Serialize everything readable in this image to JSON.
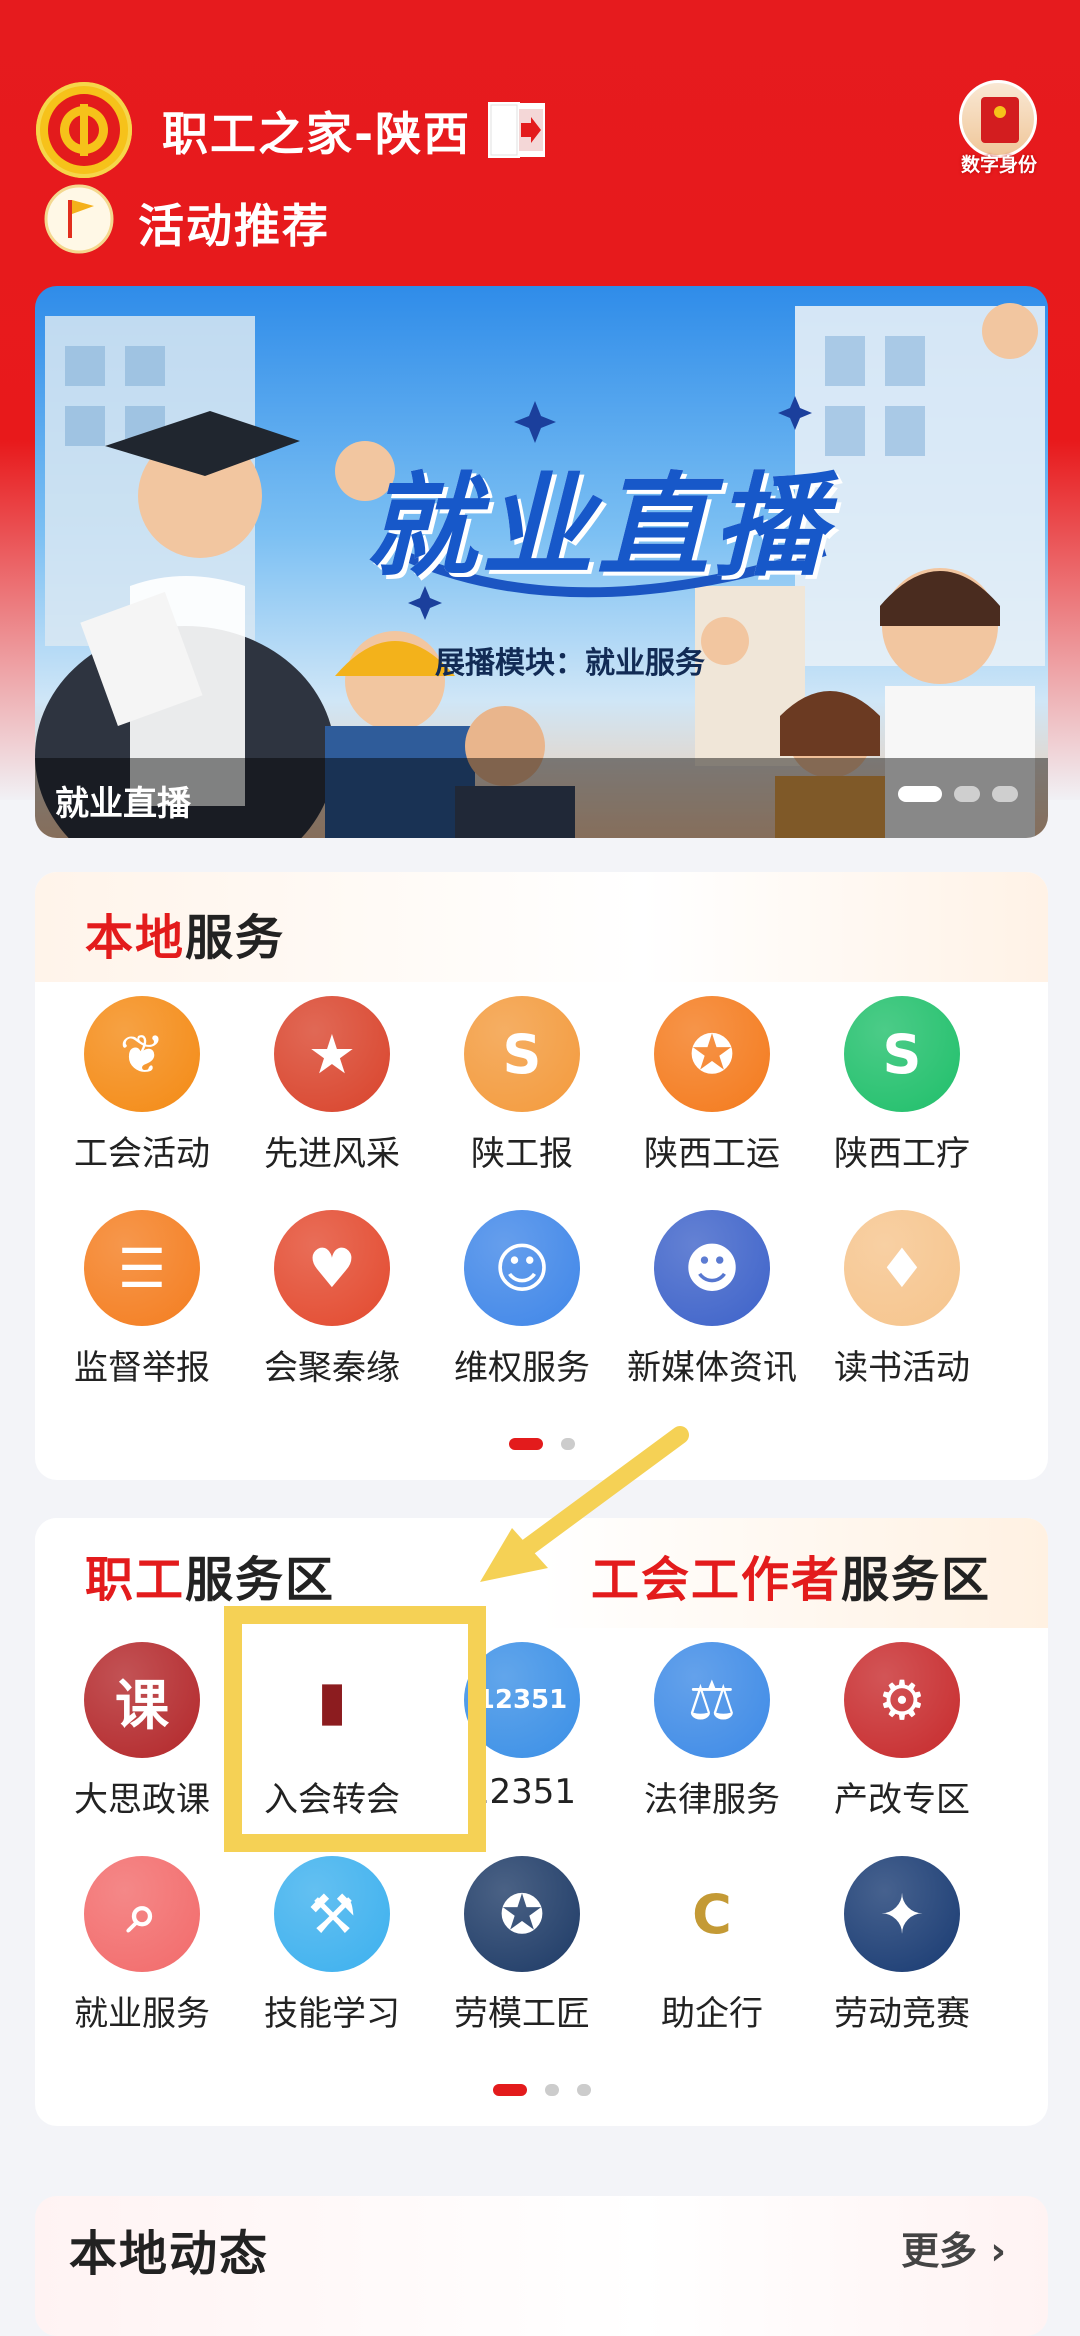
{
  "header": {
    "title": "职工之家-陕西",
    "digital_id_label": "数字身份",
    "section_title": "活动推荐"
  },
  "banner": {
    "headline": "就业直播",
    "subtitle": "展播模块：就业服务",
    "caption": "就业直播",
    "pages": 3,
    "active_page": 0
  },
  "local_services": {
    "title_highlight": "本地",
    "title_rest": "服务",
    "items": [
      {
        "label": "工会活动",
        "color": "#f48a14",
        "icon": "balloons-icon"
      },
      {
        "label": "先进风采",
        "color": "#d9432b",
        "icon": "advanced-worker-icon"
      },
      {
        "label": "陕工报",
        "color": "#f39a3c",
        "icon": "newspaper-logo-icon"
      },
      {
        "label": "陕西工运",
        "color": "#f47a1c",
        "icon": "medal-icon"
      },
      {
        "label": "陕西工疗",
        "color": "#1fbf6a",
        "icon": "sanatorium-icon"
      },
      {
        "label": "监督举报",
        "color": "#f47d1f",
        "icon": "report-document-icon"
      },
      {
        "label": "会聚秦缘",
        "color": "#e3492e",
        "icon": "couple-icon"
      },
      {
        "label": "维权服务",
        "color": "#3f86e8",
        "icon": "rights-protection-icon"
      },
      {
        "label": "新媒体资讯",
        "color": "#3d62c9",
        "icon": "news-person-icon"
      },
      {
        "label": "读书活动",
        "color": "#f6c48c",
        "icon": "reading-icon"
      }
    ],
    "pages": 2,
    "active_page": 0
  },
  "staff_services": {
    "left_title_highlight": "职工",
    "left_title_rest": "服务区",
    "right_title_highlight": "工会工作者",
    "right_title_rest": "服务区",
    "items": [
      {
        "label": "大思政课",
        "color": "#b3272a",
        "icon": "ideology-class-icon"
      },
      {
        "label": "入会转会",
        "color": "#ffffff",
        "icon": "membership-book-icon"
      },
      {
        "label": "12351",
        "color": "#3a8fe6",
        "icon": "hotline-12351-icon"
      },
      {
        "label": "法律服务",
        "color": "#3d8ae6",
        "icon": "scales-icon"
      },
      {
        "label": "产改专区",
        "color": "#c72a2c",
        "icon": "industry-reform-icon"
      },
      {
        "label": "就业服务",
        "color": "#f26a6a",
        "icon": "job-search-icon"
      },
      {
        "label": "技能学习",
        "color": "#3cb0ee",
        "icon": "skill-learning-icon"
      },
      {
        "label": "劳模工匠",
        "color": "#1d3a66",
        "icon": "model-worker-medal-icon"
      },
      {
        "label": "助企行",
        "color": "#ffffff",
        "icon": "enterprise-aid-icon"
      },
      {
        "label": "劳动竞赛",
        "color": "#183a72",
        "icon": "labor-contest-icon"
      }
    ],
    "pages": 3,
    "active_page": 0
  },
  "local_news": {
    "title": "本地动态",
    "more": "更多"
  }
}
